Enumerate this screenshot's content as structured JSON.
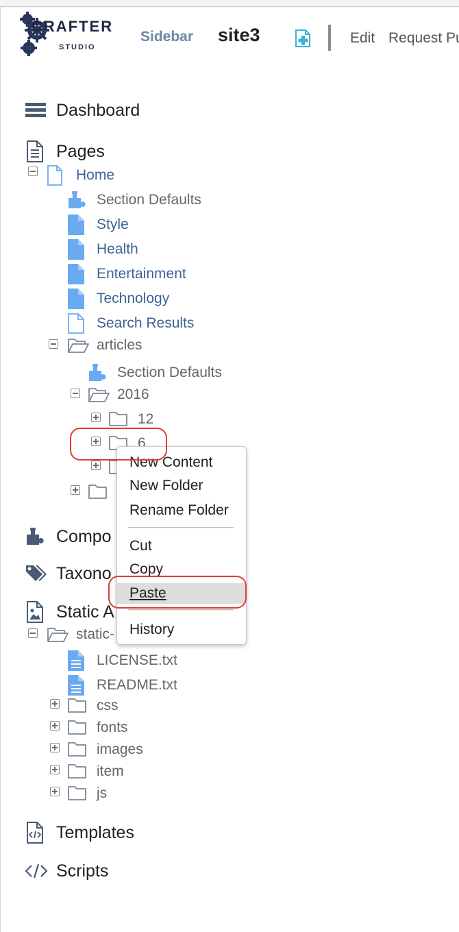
{
  "header": {
    "logo_word": "CRAFTER",
    "logo_sub": "STUDIO",
    "sidebar_label": "Sidebar",
    "site_name": "site3",
    "add_icon": "add-content-icon",
    "edit_label": "Edit",
    "request_label": "Request Pu"
  },
  "sections": {
    "dashboard": "Dashboard",
    "pages": "Pages",
    "components": "Compo",
    "taxonomy": "Taxono",
    "static_assets": "Static A",
    "templates": "Templates",
    "scripts": "Scripts"
  },
  "pages_tree": {
    "home": "Home",
    "section_defaults": "Section Defaults",
    "style": "Style",
    "health": "Health",
    "entertainment": "Entertainment",
    "technology": "Technology",
    "search_results": "Search Results",
    "articles": "articles",
    "articles_section_defaults": "Section Defaults",
    "year_2016": "2016",
    "month_12": "12",
    "month_6": "6"
  },
  "static_tree": {
    "static_root": "static-",
    "license": "LICENSE.txt",
    "readme": "README.txt",
    "css": "css",
    "fonts": "fonts",
    "images": "images",
    "item": "item",
    "js": "js"
  },
  "context_menu": {
    "items": [
      "New Content",
      "New Folder",
      "Rename Folder",
      "Cut",
      "Copy",
      "Paste",
      "History"
    ],
    "highlighted": "Paste"
  },
  "colors": {
    "link_blue": "#3d6394",
    "icon_blue": "#6aaaf0",
    "annotation_red": "#e33b2e",
    "add_icon_teal": "#39b3d7"
  }
}
